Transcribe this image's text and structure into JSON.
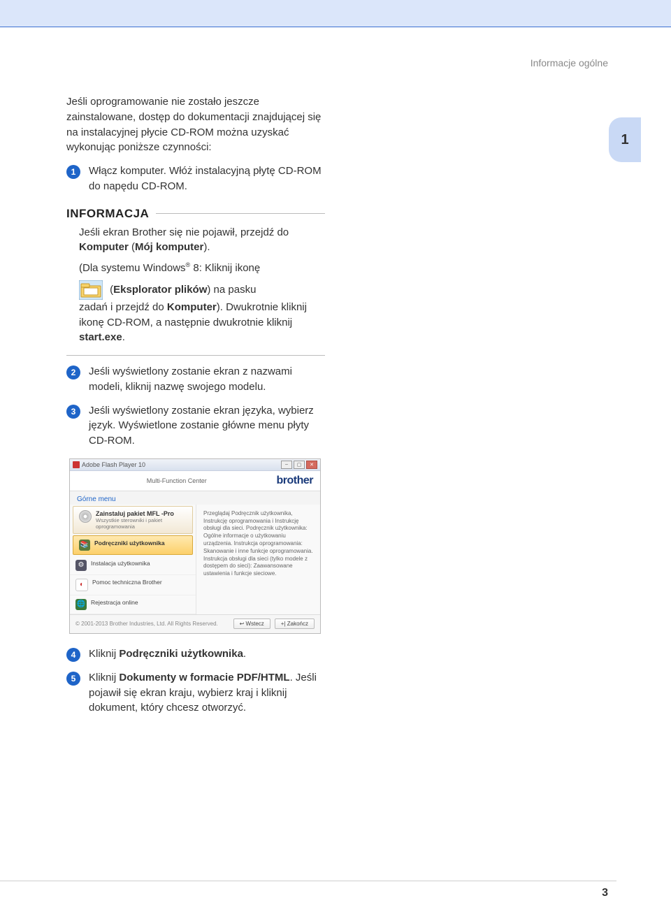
{
  "header": {
    "section_title": "Informacje ogólne",
    "chapter_number": "1"
  },
  "intro": "Jeśli oprogramowanie nie zostało jeszcze zainstalowane, dostęp do dokumentacji znajdującej się na instalacyjnej płycie CD-ROM można uzyskać wykonując poniższe czynności:",
  "steps": {
    "s1": {
      "num": "1",
      "text": "Włącz komputer. Włóż instalacyjną płytę CD-ROM do napędu CD-ROM."
    },
    "s2": {
      "num": "2",
      "text": "Jeśli wyświetlony zostanie ekran z nazwami modeli, kliknij nazwę swojego modelu."
    },
    "s3": {
      "num": "3",
      "text": "Jeśli wyświetlony zostanie ekran języka, wybierz język. Wyświetlone zostanie główne menu płyty CD-ROM."
    },
    "s4": {
      "num": "4",
      "pre": "Kliknij ",
      "bold": "Podręczniki użytkownika",
      "post": "."
    },
    "s5": {
      "num": "5",
      "pre": "Kliknij ",
      "bold": "Dokumenty w formacie PDF/HTML",
      "post": ". Jeśli pojawił się ekran kraju, wybierz kraj i kliknij dokument, który chcesz otworzyć."
    }
  },
  "info": {
    "heading": "INFORMACJA",
    "p1_pre": "Jeśli ekran Brother się nie pojawił, przejdź do ",
    "p1_b1": "Komputer",
    "p1_mid": " (",
    "p1_b2": "Mój komputer",
    "p1_post": ").",
    "p2_pre": "(Dla systemu Windows",
    "p2_sup": "®",
    "p2_post": " 8: Kliknij ikonę",
    "p3_mid_pre": " (",
    "p3_b1": "Eksplorator plików",
    "p3_mid_post": ") na pasku",
    "p4_pre": "zadań i przejdź do ",
    "p4_b1": "Komputer",
    "p4_mid": "). Dwukrotnie kliknij ikonę CD-ROM, a następnie dwukrotnie kliknij ",
    "p4_b2": "start.exe",
    "p4_post": "."
  },
  "shot": {
    "titlebar": "Adobe Flash Player 10",
    "header_center": "Multi-Function Center",
    "brand": "brother",
    "menu_label": "Górne menu",
    "items": {
      "install": {
        "title": "Zainstaluj pakiet MFL -Pro",
        "sub": "Wszystkie sterowniki i pakiet oprogramowania"
      },
      "manuals": "Podręczniki użytkownika",
      "custom": "Instalacja użytkownika",
      "support": "Pomoc techniczna Brother",
      "register": "Rejestracja online"
    },
    "desc": "Przeglądaj Podręcznik użytkownika, Instrukcję oprogramowania i Instrukcję obsługi dla sieci. Podręcznik użytkownika: Ogólne informacje o użytkowaniu urządzenia. Instrukcja oprogramowania: Skanowanie i inne funkcje oprogramowania. Instrukcja obsługi dla sieci (tylko modele z dostępem do sieci): Zaawansowane ustawienia i funkcje sieciowe.",
    "copyright": "© 2001-2013 Brother Industries, Ltd. All Rights Reserved.",
    "back": "Wstecz",
    "exit": "Zakończ"
  },
  "page_number": "3"
}
